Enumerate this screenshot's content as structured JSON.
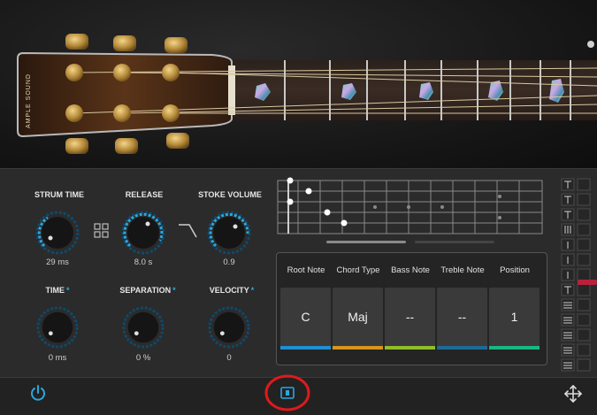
{
  "brand": {
    "logo_text": "AMPLE SOUND"
  },
  "knobs_row1": [
    {
      "label": "STRUM TIME",
      "value": "29 ms",
      "level": 0.35
    },
    {
      "label": "RELEASE",
      "value": "8.0 s",
      "level": 0.75
    },
    {
      "label": "STOKE VOLUME",
      "value": "0.9",
      "level": 0.85
    }
  ],
  "knobs_row2": [
    {
      "label": "TIME",
      "star": "*",
      "value": "0 ms",
      "level": 0.0
    },
    {
      "label": "SEPARATION",
      "star": "*",
      "value": "0 %",
      "level": 0.0
    },
    {
      "label": "VELOCITY",
      "star": "*",
      "value": "0",
      "level": 0.0
    }
  ],
  "chord": {
    "headers": [
      "Root Note",
      "Chord Type",
      "Bass Note",
      "Treble Note",
      "Position"
    ],
    "values": [
      "C",
      "Maj",
      "--",
      "--",
      "1"
    ],
    "colors": [
      "#1e8fd0",
      "#d8951c",
      "#8fbf28",
      "#1e6a96",
      "#18b880"
    ]
  },
  "icons": {
    "power": "power-icon",
    "grid": "grid-icon",
    "release_curve": "release-curve-icon",
    "tab_view": "tab-view-icon",
    "move": "move-arrows-icon"
  },
  "colors": {
    "accent": "#29a8e0",
    "highlight_ring": "#e0191b"
  }
}
